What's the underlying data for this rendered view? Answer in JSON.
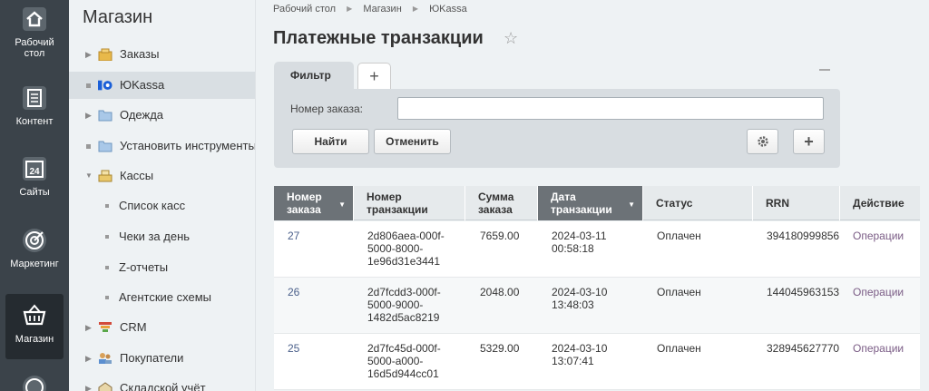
{
  "rail": {
    "items": [
      {
        "label_line1": "Рабочий",
        "label_line2": "стол"
      },
      {
        "label_line1": "Контент",
        "label_line2": ""
      },
      {
        "label_line1": "Сайты",
        "label_line2": ""
      },
      {
        "label_line1": "Маркетинг",
        "label_line2": ""
      },
      {
        "label_line1": "Магазин",
        "label_line2": ""
      }
    ],
    "calendar_day": "24"
  },
  "sidebar": {
    "title": "Магазин",
    "items": [
      {
        "label": "Заказы"
      },
      {
        "label": "ЮKassa"
      },
      {
        "label": "Одежда"
      },
      {
        "label": "Установить инструменты и"
      },
      {
        "label": "Кассы"
      },
      {
        "label": "Список касс"
      },
      {
        "label": "Чеки за день"
      },
      {
        "label": "Z-отчеты"
      },
      {
        "label": "Агентские схемы"
      },
      {
        "label": "CRM"
      },
      {
        "label": "Покупатели"
      },
      {
        "label": "Складской учёт"
      }
    ]
  },
  "breadcrumb": {
    "items": [
      "Рабочий стол",
      "Магазин",
      "ЮKassa"
    ]
  },
  "page": {
    "title": "Платежные транзакции"
  },
  "filter": {
    "tab_label": "Фильтр",
    "add_tab": "+",
    "order_label": "Номер заказа:",
    "order_value": "",
    "find_label": "Найти",
    "cancel_label": "Отменить",
    "add_label": "+"
  },
  "table": {
    "headers": [
      {
        "line1": "Номер",
        "line2": "заказа"
      },
      {
        "line1": "Номер",
        "line2": "транзакции"
      },
      {
        "line1": "Сумма",
        "line2": "заказа"
      },
      {
        "line1": "Дата",
        "line2": "транзакции"
      },
      {
        "line1": "Статус",
        "line2": ""
      },
      {
        "line1": "RRN",
        "line2": ""
      },
      {
        "line1": "Действие",
        "line2": ""
      }
    ],
    "rows": [
      {
        "order": "27",
        "tx1": "2d806aea-000f-",
        "tx2": "5000-8000-",
        "tx3": "1e96d31e3441",
        "sum": "7659.00",
        "date": "2024-03-11",
        "time": "00:58:18",
        "status": "Оплачен",
        "rrn": "394180999856",
        "action": "Операции"
      },
      {
        "order": "26",
        "tx1": "2d7fcdd3-000f-",
        "tx2": "5000-9000-",
        "tx3": "1482d5ac8219",
        "sum": "2048.00",
        "date": "2024-03-10",
        "time": "13:48:03",
        "status": "Оплачен",
        "rrn": "144045963153",
        "action": "Операции"
      },
      {
        "order": "25",
        "tx1": "2d7fc45d-000f-",
        "tx2": "5000-a000-",
        "tx3": "16d5d944cc01",
        "sum": "5329.00",
        "date": "2024-03-10",
        "time": "13:07:41",
        "status": "Оплачен",
        "rrn": "328945627770",
        "action": "Операции"
      }
    ]
  }
}
